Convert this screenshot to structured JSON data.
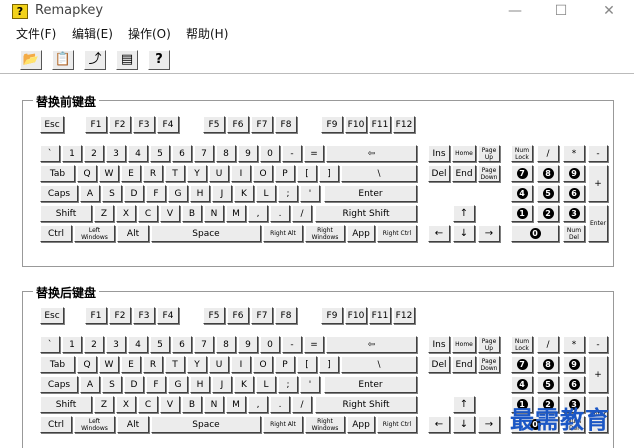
{
  "window": {
    "title": "Remapkey",
    "app_icon": "?",
    "minimize": "—",
    "maximize": "☐",
    "close": "✕"
  },
  "menu": [
    "文件(F)",
    "编辑(E)",
    "操作(O)",
    "帮助(H)"
  ],
  "toolbar": [
    {
      "name": "open-icon",
      "glyph": "📂"
    },
    {
      "name": "remove-icon",
      "glyph": "📋"
    },
    {
      "name": "restore-icon",
      "glyph": "⤴"
    },
    {
      "name": "list-icon",
      "glyph": "▤"
    },
    {
      "name": "help-icon",
      "glyph": "?"
    }
  ],
  "panels": {
    "base": "替换前键盘",
    "remapped": "替换后键盘"
  },
  "keyboard": {
    "fn_row": [
      "Esc",
      "F1",
      "F2",
      "F3",
      "F4",
      "F5",
      "F6",
      "F7",
      "F8",
      "F9",
      "F10",
      "F11",
      "F12"
    ],
    "num_row": [
      "`",
      "1",
      "2",
      "3",
      "4",
      "5",
      "6",
      "7",
      "8",
      "9",
      "0",
      "-",
      "=",
      "⇦"
    ],
    "tab_row": [
      "Tab",
      "Q",
      "W",
      "E",
      "R",
      "T",
      "Y",
      "U",
      "I",
      "O",
      "P",
      "[",
      "]",
      "\\"
    ],
    "caps_row": [
      "Caps",
      "A",
      "S",
      "D",
      "F",
      "G",
      "H",
      "J",
      "K",
      "L",
      ";",
      "'",
      "Enter"
    ],
    "shift_row": [
      "Shift",
      "Z",
      "X",
      "C",
      "V",
      "B",
      "N",
      "M",
      ",",
      ".",
      "/",
      "Right Shift"
    ],
    "ctrl_row": [
      "Ctrl",
      "Left Windows",
      "Alt",
      "Space",
      "Right Alt",
      "Right Windows",
      "App",
      "Right Ctrl"
    ],
    "nav_top": [
      "Ins",
      "Home",
      "Page Up"
    ],
    "nav_bottom": [
      "Del",
      "End",
      "Page Down"
    ],
    "arrows": [
      "↑",
      "←",
      "↓",
      "→"
    ],
    "numpad_top": [
      "Num Lock",
      "/",
      "*",
      "-"
    ],
    "numpad_r1": [
      "7",
      "8",
      "9"
    ],
    "numpad_r2": [
      "4",
      "5",
      "6"
    ],
    "numpad_r3": [
      "1",
      "2",
      "3"
    ],
    "numpad_plus": "+",
    "numpad_enter": "Enter",
    "numpad_0": "0",
    "numpad_del": "Num Del"
  },
  "watermark": "最需教育"
}
